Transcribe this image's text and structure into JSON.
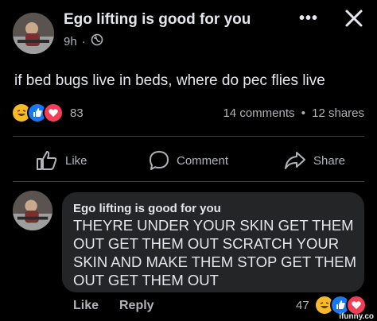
{
  "post": {
    "author": "Ego lifting is good for you",
    "time": "9h",
    "separator": "·",
    "more_label": "•••",
    "close_label": "X",
    "text": "if bed bugs live in beds, where do pec flies live",
    "reaction_count": "83",
    "comments": "14 comments",
    "stat_sep": "•",
    "shares": "12 shares"
  },
  "actions": {
    "like": "Like",
    "comment": "Comment",
    "share": "Share"
  },
  "comment": {
    "author": "Ego lifting is good for you",
    "text": "THEYRE UNDER YOUR SKIN GET THEM OUT GET THEM OUT SCRATCH YOUR SKIN AND MAKE THEM STOP GET THEM OUT GET THEM OUT",
    "like": "Like",
    "reply": "Reply",
    "reaction_count": "47"
  },
  "watermark": "ifunny.co",
  "colors": {
    "background": "#000000",
    "bubble": "#242526",
    "text": "#e4e6eb",
    "secondary": "#b0b3b8",
    "like_blue": "#1877f2",
    "love_red": "#f33e58",
    "haha_yellow": "#f7b928"
  }
}
